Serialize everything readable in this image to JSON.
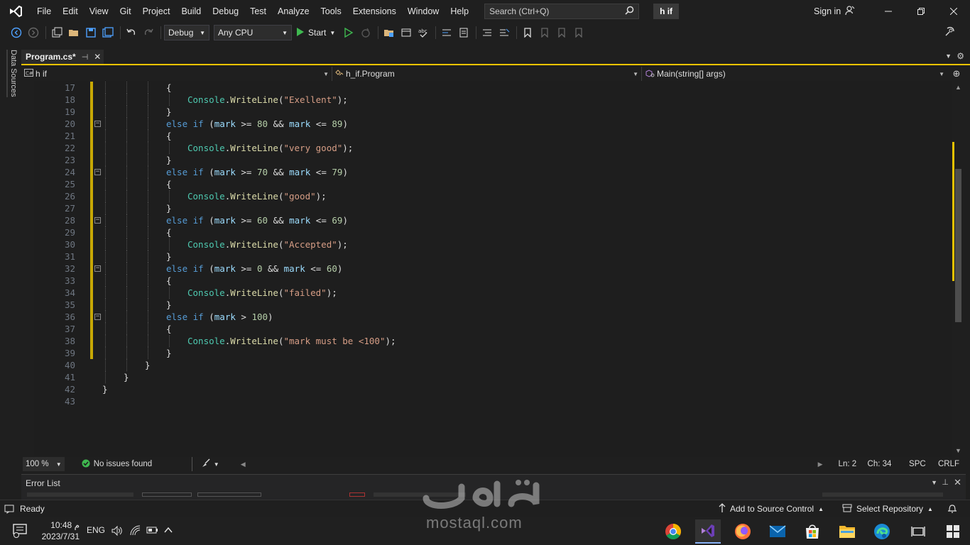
{
  "menu": {
    "items": [
      "File",
      "Edit",
      "View",
      "Git",
      "Project",
      "Build",
      "Debug",
      "Test",
      "Analyze",
      "Tools",
      "Extensions",
      "Window",
      "Help"
    ],
    "search_placeholder": "Search (Ctrl+Q)",
    "solution_name": "h if",
    "sign_in": "Sign in"
  },
  "toolbar": {
    "configuration": "Debug",
    "platform": "Any CPU",
    "start_label": "Start"
  },
  "left_panel": {
    "data_sources": "Data Sources"
  },
  "tabs": [
    {
      "label": "Program.cs*"
    }
  ],
  "navbar": {
    "project": "h if",
    "type": "h_if.Program",
    "member": "Main(string[] args)"
  },
  "editor": {
    "lines": [
      {
        "n": "17",
        "indent": 3,
        "fold": false,
        "changed": true,
        "tokens": [
          [
            "pun",
            "{"
          ]
        ]
      },
      {
        "n": "18",
        "indent": 4,
        "fold": false,
        "changed": true,
        "tokens": [
          [
            "cls",
            "Console"
          ],
          [
            "pun",
            "."
          ],
          [
            "fn",
            "WriteLine"
          ],
          [
            "pun",
            "("
          ],
          [
            "str",
            "\"Exellent\""
          ],
          [
            "pun",
            ");"
          ]
        ]
      },
      {
        "n": "19",
        "indent": 3,
        "fold": false,
        "changed": true,
        "tokens": [
          [
            "pun",
            "}"
          ]
        ]
      },
      {
        "n": "20",
        "indent": 3,
        "fold": true,
        "changed": true,
        "tokens": [
          [
            "kw",
            "else"
          ],
          [
            "pun",
            " "
          ],
          [
            "kw",
            "if"
          ],
          [
            "pun",
            " ("
          ],
          [
            "id",
            "mark"
          ],
          [
            "pun",
            " >= "
          ],
          [
            "num",
            "80"
          ],
          [
            "pun",
            " && "
          ],
          [
            "id",
            "mark"
          ],
          [
            "pun",
            " <= "
          ],
          [
            "num",
            "89"
          ],
          [
            "pun",
            ")"
          ]
        ]
      },
      {
        "n": "21",
        "indent": 3,
        "fold": false,
        "changed": true,
        "tokens": [
          [
            "pun",
            "{"
          ]
        ]
      },
      {
        "n": "22",
        "indent": 4,
        "fold": false,
        "changed": true,
        "tokens": [
          [
            "cls",
            "Console"
          ],
          [
            "pun",
            "."
          ],
          [
            "fn",
            "WriteLine"
          ],
          [
            "pun",
            "("
          ],
          [
            "str",
            "\"very good\""
          ],
          [
            "pun",
            ");"
          ]
        ]
      },
      {
        "n": "23",
        "indent": 3,
        "fold": false,
        "changed": true,
        "tokens": [
          [
            "pun",
            "}"
          ]
        ]
      },
      {
        "n": "24",
        "indent": 3,
        "fold": true,
        "changed": true,
        "tokens": [
          [
            "kw",
            "else"
          ],
          [
            "pun",
            " "
          ],
          [
            "kw",
            "if"
          ],
          [
            "pun",
            " ("
          ],
          [
            "id",
            "mark"
          ],
          [
            "pun",
            " >= "
          ],
          [
            "num",
            "70"
          ],
          [
            "pun",
            " && "
          ],
          [
            "id",
            "mark"
          ],
          [
            "pun",
            " <= "
          ],
          [
            "num",
            "79"
          ],
          [
            "pun",
            ")"
          ]
        ]
      },
      {
        "n": "25",
        "indent": 3,
        "fold": false,
        "changed": true,
        "tokens": [
          [
            "pun",
            "{"
          ]
        ]
      },
      {
        "n": "26",
        "indent": 4,
        "fold": false,
        "changed": true,
        "tokens": [
          [
            "cls",
            "Console"
          ],
          [
            "pun",
            "."
          ],
          [
            "fn",
            "WriteLine"
          ],
          [
            "pun",
            "("
          ],
          [
            "str",
            "\"good\""
          ],
          [
            "pun",
            ");"
          ]
        ]
      },
      {
        "n": "27",
        "indent": 3,
        "fold": false,
        "changed": true,
        "tokens": [
          [
            "pun",
            "}"
          ]
        ]
      },
      {
        "n": "28",
        "indent": 3,
        "fold": true,
        "changed": true,
        "tokens": [
          [
            "kw",
            "else"
          ],
          [
            "pun",
            " "
          ],
          [
            "kw",
            "if"
          ],
          [
            "pun",
            " ("
          ],
          [
            "id",
            "mark"
          ],
          [
            "pun",
            " >= "
          ],
          [
            "num",
            "60"
          ],
          [
            "pun",
            " && "
          ],
          [
            "id",
            "mark"
          ],
          [
            "pun",
            " <= "
          ],
          [
            "num",
            "69"
          ],
          [
            "pun",
            ")"
          ]
        ]
      },
      {
        "n": "29",
        "indent": 3,
        "fold": false,
        "changed": true,
        "tokens": [
          [
            "pun",
            "{"
          ]
        ]
      },
      {
        "n": "30",
        "indent": 4,
        "fold": false,
        "changed": true,
        "tokens": [
          [
            "cls",
            "Console"
          ],
          [
            "pun",
            "."
          ],
          [
            "fn",
            "WriteLine"
          ],
          [
            "pun",
            "("
          ],
          [
            "str",
            "\"Accepted\""
          ],
          [
            "pun",
            ");"
          ]
        ]
      },
      {
        "n": "31",
        "indent": 3,
        "fold": false,
        "changed": true,
        "tokens": [
          [
            "pun",
            "}"
          ]
        ]
      },
      {
        "n": "32",
        "indent": 3,
        "fold": true,
        "changed": true,
        "tokens": [
          [
            "kw",
            "else"
          ],
          [
            "pun",
            " "
          ],
          [
            "kw",
            "if"
          ],
          [
            "pun",
            " ("
          ],
          [
            "id",
            "mark"
          ],
          [
            "pun",
            " >= "
          ],
          [
            "num",
            "0"
          ],
          [
            "pun",
            " && "
          ],
          [
            "id",
            "mark"
          ],
          [
            "pun",
            " <= "
          ],
          [
            "num",
            "60"
          ],
          [
            "pun",
            ")"
          ]
        ]
      },
      {
        "n": "33",
        "indent": 3,
        "fold": false,
        "changed": true,
        "tokens": [
          [
            "pun",
            "{"
          ]
        ]
      },
      {
        "n": "34",
        "indent": 4,
        "fold": false,
        "changed": true,
        "tokens": [
          [
            "cls",
            "Console"
          ],
          [
            "pun",
            "."
          ],
          [
            "fn",
            "WriteLine"
          ],
          [
            "pun",
            "("
          ],
          [
            "str",
            "\"failed\""
          ],
          [
            "pun",
            ");"
          ]
        ]
      },
      {
        "n": "35",
        "indent": 3,
        "fold": false,
        "changed": true,
        "tokens": [
          [
            "pun",
            "}"
          ]
        ]
      },
      {
        "n": "36",
        "indent": 3,
        "fold": true,
        "changed": true,
        "tokens": [
          [
            "kw",
            "else"
          ],
          [
            "pun",
            " "
          ],
          [
            "kw",
            "if"
          ],
          [
            "pun",
            " ("
          ],
          [
            "id",
            "mark"
          ],
          [
            "pun",
            " > "
          ],
          [
            "num",
            "100"
          ],
          [
            "pun",
            ")"
          ]
        ]
      },
      {
        "n": "37",
        "indent": 3,
        "fold": false,
        "changed": true,
        "tokens": [
          [
            "pun",
            "{"
          ]
        ]
      },
      {
        "n": "38",
        "indent": 4,
        "fold": false,
        "changed": true,
        "tokens": [
          [
            "cls",
            "Console"
          ],
          [
            "pun",
            "."
          ],
          [
            "fn",
            "WriteLine"
          ],
          [
            "pun",
            "("
          ],
          [
            "str",
            "\"mark must be <100\""
          ],
          [
            "pun",
            ");"
          ]
        ]
      },
      {
        "n": "39",
        "indent": 3,
        "fold": false,
        "changed": true,
        "tokens": [
          [
            "pun",
            "}"
          ]
        ]
      },
      {
        "n": "40",
        "indent": 2,
        "fold": false,
        "changed": false,
        "tokens": [
          [
            "pun",
            "}"
          ]
        ]
      },
      {
        "n": "41",
        "indent": 1,
        "fold": false,
        "changed": false,
        "tokens": [
          [
            "pun",
            "}"
          ]
        ]
      },
      {
        "n": "42",
        "indent": 0,
        "fold": false,
        "changed": false,
        "tokens": [
          [
            "pun",
            "}"
          ]
        ]
      },
      {
        "n": "43",
        "indent": 0,
        "fold": false,
        "changed": false,
        "tokens": []
      }
    ]
  },
  "editor_status": {
    "zoom": "100 %",
    "issues": "No issues found",
    "line": "Ln: 2",
    "column": "Ch: 34",
    "whitespace": "SPC",
    "line_ending": "CRLF"
  },
  "error_list": {
    "title": "Error List"
  },
  "statusbar": {
    "ready": "Ready",
    "source_control": "Add to Source Control",
    "repository": "Select Repository"
  },
  "taskbar": {
    "time": "10:48 م",
    "date": "2023/7/31",
    "language": "ENG"
  },
  "watermark": {
    "text": "mostaql.com"
  },
  "colors": {
    "accent_tab": "#f5c400",
    "change_marker": "#e5c100",
    "ok_green": "#3fb950"
  }
}
